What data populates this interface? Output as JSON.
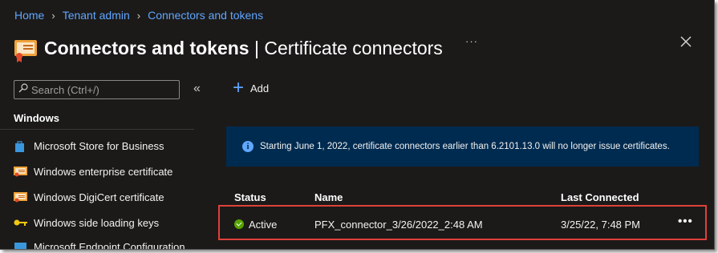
{
  "breadcrumb": {
    "items": [
      "Home",
      "Tenant admin",
      "Connectors and tokens"
    ]
  },
  "header": {
    "title_main": "Connectors and tokens",
    "title_sep": " | ",
    "title_sub": "Certificate connectors",
    "more_label": "···"
  },
  "sidebar": {
    "search_placeholder": "Search (Ctrl+/)",
    "collapse_label": "«",
    "section": "Windows",
    "items": [
      {
        "label": "Microsoft Store for Business",
        "icon": "store-bag-icon"
      },
      {
        "label": "Windows enterprise certificate",
        "icon": "certificate-icon"
      },
      {
        "label": "Windows DigiCert certificate",
        "icon": "certificate-icon"
      },
      {
        "label": "Windows side loading keys",
        "icon": "key-icon"
      },
      {
        "label": "Microsoft Endpoint Configuration",
        "icon": "config-icon"
      }
    ]
  },
  "toolbar": {
    "add_label": "Add"
  },
  "banner": {
    "text": "Starting June 1, 2022, certificate connectors earlier than 6.2101.13.0 will no longer issue certificates."
  },
  "table": {
    "headers": {
      "status": "Status",
      "name": "Name",
      "last_connected": "Last Connected"
    },
    "rows": [
      {
        "status": "Active",
        "name": "PFX_connector_3/26/2022_2:48 AM",
        "last_connected": "3/25/22, 7:48 PM",
        "more": "•••"
      }
    ]
  },
  "colors": {
    "background": "#1b1a19",
    "link": "#60a6ff",
    "banner": "#002b50",
    "status_active": "#57a300",
    "highlight": "#e0403a"
  }
}
